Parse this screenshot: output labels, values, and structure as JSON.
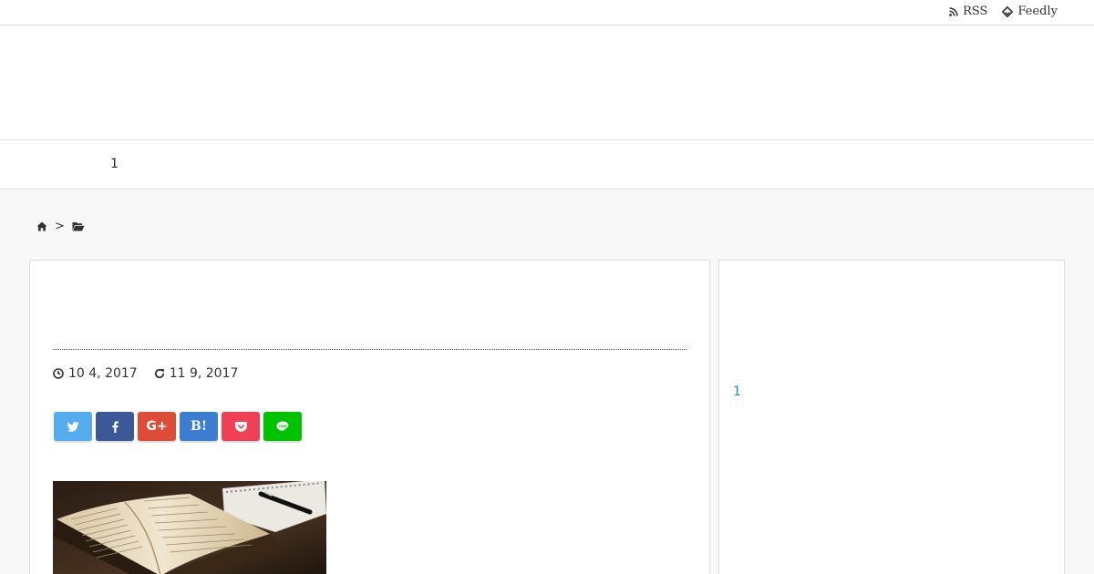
{
  "topbar": {
    "rss_label": "RSS",
    "feedly_label": "Feedly"
  },
  "nav": {
    "item_label": "1"
  },
  "breadcrumb": {
    "separator": ">"
  },
  "article": {
    "published_date": "10 4, 2017",
    "updated_date": "11 9, 2017",
    "share_buttons": [
      {
        "name": "twitter",
        "color": "#55acee"
      },
      {
        "name": "facebook",
        "color": "#3b5998"
      },
      {
        "name": "google-plus",
        "label": "G+",
        "color": "#dd4b39"
      },
      {
        "name": "hatena",
        "label": "B!",
        "color": "#3c7dd1"
      },
      {
        "name": "pocket",
        "color": "#ef4056"
      },
      {
        "name": "line",
        "color": "#00c300"
      }
    ]
  },
  "sidebar": {
    "link_label": "1"
  },
  "colors": {
    "link": "#1e88c7",
    "border": "#dddddd",
    "page_background": "#f8f8f8"
  }
}
